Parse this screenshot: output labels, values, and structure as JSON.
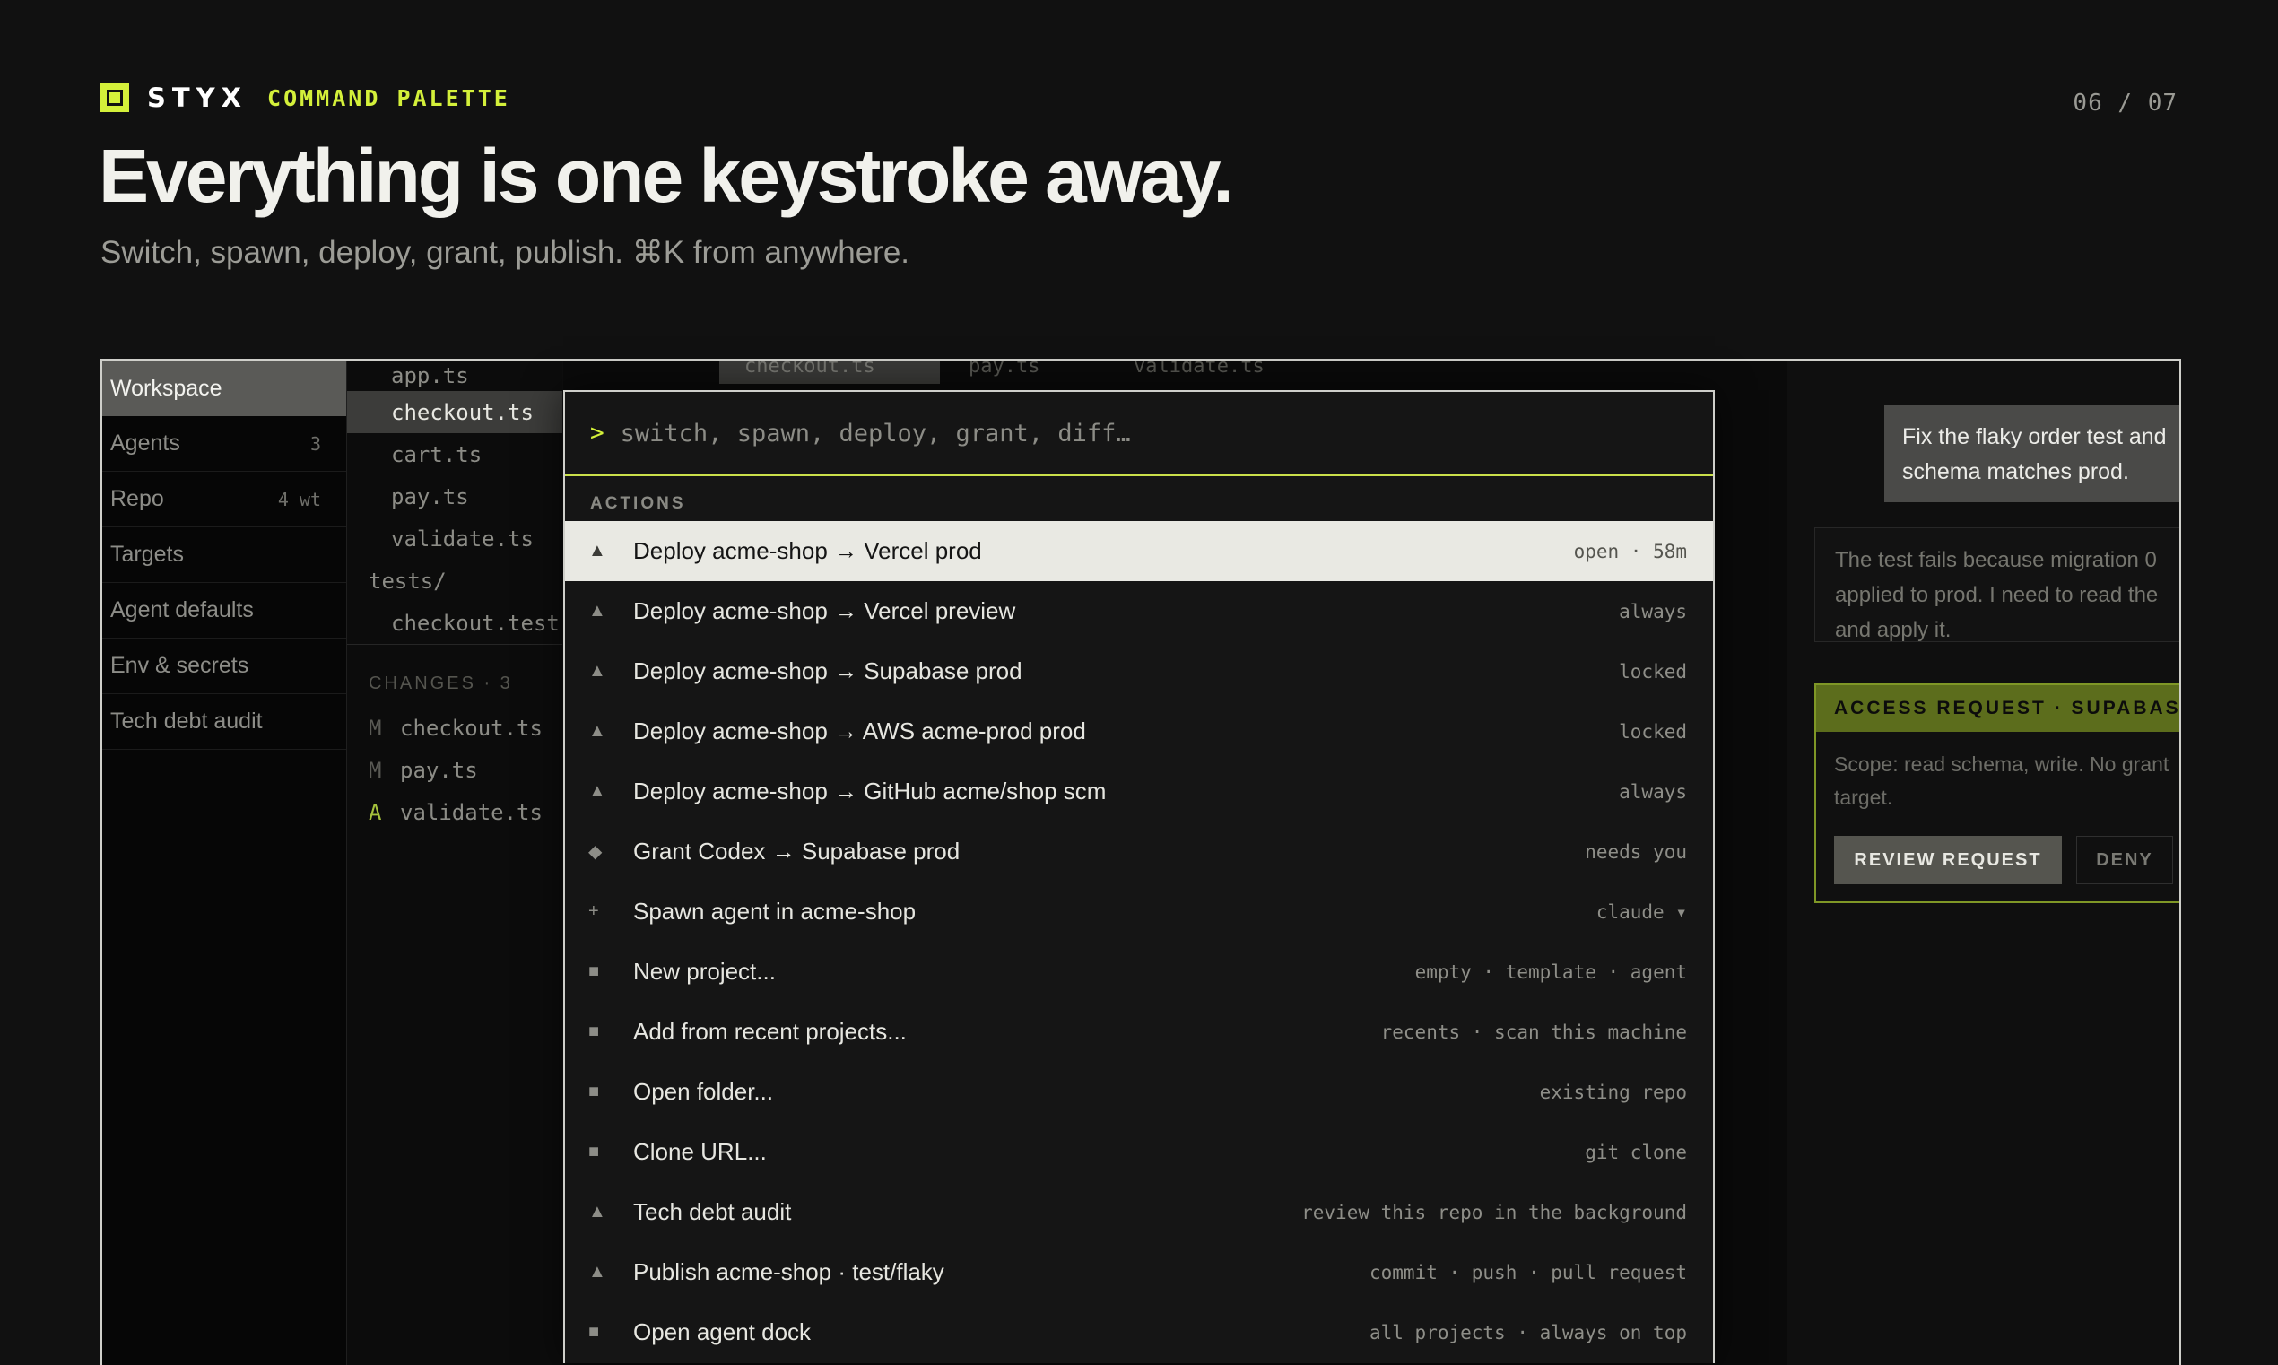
{
  "header": {
    "brand_name": "STYX",
    "section": "COMMAND PALETTE",
    "page_counter": "06 / 07",
    "headline": "Everything is one keystroke away.",
    "subhead": "Switch, spawn, deploy, grant, publish. ⌘K from anywhere.",
    "accent_color": "#d4f03a"
  },
  "sidebar": {
    "items": [
      {
        "label": "Workspace",
        "count": ""
      },
      {
        "label": "Agents",
        "count": "3"
      },
      {
        "label": "Repo",
        "count": "4 wt"
      },
      {
        "label": "Targets",
        "count": ""
      },
      {
        "label": "Agent defaults",
        "count": ""
      },
      {
        "label": "Env & secrets",
        "count": ""
      },
      {
        "label": "Tech debt audit",
        "count": ""
      }
    ]
  },
  "filetree": {
    "files": [
      "app.ts",
      "checkout.ts",
      "cart.ts",
      "pay.ts",
      "validate.ts"
    ],
    "folder": "tests/",
    "test_file": "checkout.test.ts",
    "changes_header": "CHANGES · 3",
    "changes": [
      {
        "status": "M",
        "file": "checkout.ts"
      },
      {
        "status": "M",
        "file": "pay.ts"
      },
      {
        "status": "A",
        "file": "validate.ts"
      }
    ]
  },
  "editor": {
    "tabs": [
      "checkout.ts",
      "pay.ts",
      "validate.ts"
    ]
  },
  "chat": {
    "user_message_line1": "Fix the flaky order test and",
    "user_message_line2": "schema matches prod.",
    "agent_line1": "The test fails because migration 0",
    "agent_line2": "applied to prod. I need to read the",
    "agent_line3": "and apply it.",
    "access_header": "ACCESS REQUEST · SUPABASE PROD",
    "access_scope_line1": "Scope: read schema, write. No grant",
    "access_scope_line2": "target.",
    "review_label": "REVIEW REQUEST",
    "deny_label": "DENY"
  },
  "palette": {
    "prompt_symbol": ">",
    "placeholder": "switch, spawn, deploy, grant, diff…",
    "section_label": "ACTIONS",
    "items": [
      {
        "icon": "triangle-icon",
        "glyph": "▲",
        "label": "Deploy acme-shop → Vercel prod",
        "hint": "open · 58m"
      },
      {
        "icon": "triangle-icon",
        "glyph": "▲",
        "label": "Deploy acme-shop → Vercel preview",
        "hint": "always"
      },
      {
        "icon": "triangle-icon",
        "glyph": "▲",
        "label": "Deploy acme-shop → Supabase prod",
        "hint": "locked"
      },
      {
        "icon": "triangle-icon",
        "glyph": "▲",
        "label": "Deploy acme-shop → AWS acme-prod prod",
        "hint": "locked"
      },
      {
        "icon": "triangle-icon",
        "glyph": "▲",
        "label": "Deploy acme-shop → GitHub acme/shop scm",
        "hint": "always"
      },
      {
        "icon": "diamond-icon",
        "glyph": "◆",
        "label": "Grant Codex → Supabase prod",
        "hint": "needs you"
      },
      {
        "icon": "plus-icon",
        "glyph": "+",
        "label": "Spawn agent in acme-shop",
        "hint": "claude ▾"
      },
      {
        "icon": "square-icon",
        "glyph": "■",
        "label": "New project...",
        "hint": "empty · template · agent"
      },
      {
        "icon": "square-icon",
        "glyph": "■",
        "label": "Add from recent projects...",
        "hint": "recents · scan this machine"
      },
      {
        "icon": "square-icon",
        "glyph": "■",
        "label": "Open folder...",
        "hint": "existing repo"
      },
      {
        "icon": "square-icon",
        "glyph": "■",
        "label": "Clone URL...",
        "hint": "git clone"
      },
      {
        "icon": "triangle-icon",
        "glyph": "▲",
        "label": "Tech debt audit",
        "hint": "review this repo in the background"
      },
      {
        "icon": "triangle-icon",
        "glyph": "▲",
        "label": "Publish acme-shop · test/flaky",
        "hint": "commit · push · pull request"
      },
      {
        "icon": "square-icon",
        "glyph": "■",
        "label": "Open agent dock",
        "hint": "all projects · always on top"
      }
    ]
  }
}
